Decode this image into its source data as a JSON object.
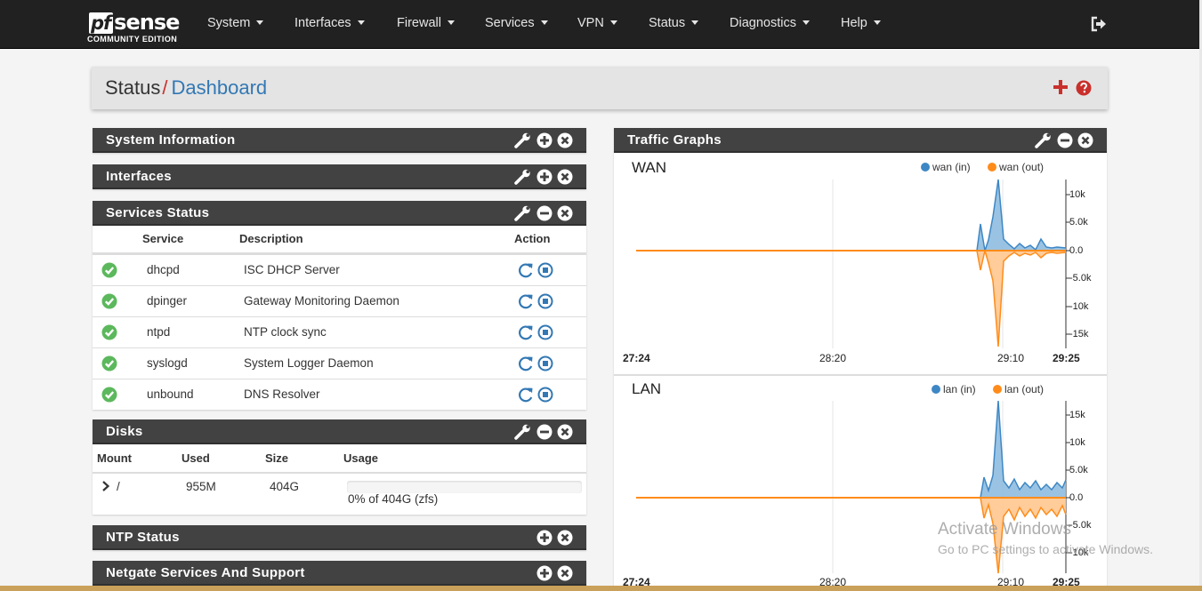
{
  "brand": {
    "logo_pf": "pf",
    "logo_sense": "sense",
    "edition": "COMMUNITY EDITION"
  },
  "nav": {
    "items": [
      "System",
      "Interfaces",
      "Firewall",
      "Services",
      "VPN",
      "Status",
      "Diagnostics",
      "Help"
    ]
  },
  "header": {
    "section": "Status",
    "separator": "/",
    "page": "Dashboard"
  },
  "widgets": {
    "system_information": {
      "title": "System Information"
    },
    "interfaces": {
      "title": "Interfaces"
    },
    "services_status": {
      "title": "Services Status",
      "columns": [
        "Service",
        "Description",
        "Action"
      ],
      "rows": [
        {
          "service": "dhcpd",
          "description": "ISC DHCP Server"
        },
        {
          "service": "dpinger",
          "description": "Gateway Monitoring Daemon"
        },
        {
          "service": "ntpd",
          "description": "NTP clock sync"
        },
        {
          "service": "syslogd",
          "description": "System Logger Daemon"
        },
        {
          "service": "unbound",
          "description": "DNS Resolver"
        }
      ]
    },
    "disks": {
      "title": "Disks",
      "columns": [
        "Mount",
        "Used",
        "Size",
        "Usage"
      ],
      "rows": [
        {
          "mount": "/",
          "used": "955M",
          "size": "404G",
          "usage_text": "0% of 404G (zfs)",
          "usage_fraction": 0.0
        }
      ]
    },
    "ntp_status": {
      "title": "NTP Status"
    },
    "netgate_support": {
      "title": "Netgate Services And Support"
    },
    "traffic_graphs": {
      "title": "Traffic Graphs",
      "colors": {
        "in": "#3e87c5",
        "out": "#ff8c1a",
        "in_fill": "#8fbde0",
        "out_fill": "#ffc68f"
      },
      "graphs": [
        {
          "name": "WAN",
          "legend_in": "wan (in)",
          "legend_out": "wan (out)",
          "y_ticks": [
            "10k",
            "5.0k",
            "0.0",
            "-5.0k",
            "-10k",
            "-15k"
          ],
          "x_ticks": [
            "27:24",
            "28:20",
            "29:10",
            "29:25"
          ]
        },
        {
          "name": "LAN",
          "legend_in": "lan (in)",
          "legend_out": "lan (out)",
          "y_ticks": [
            "15k",
            "10k",
            "5.0k",
            "0.0",
            "-5.0k",
            "-10k"
          ],
          "x_ticks": [
            "27:24",
            "28:20",
            "29:10",
            "29:25"
          ]
        }
      ]
    }
  },
  "watermark": {
    "line1": "Activate Windows",
    "line2": "Go to PC settings to activate Windows."
  }
}
